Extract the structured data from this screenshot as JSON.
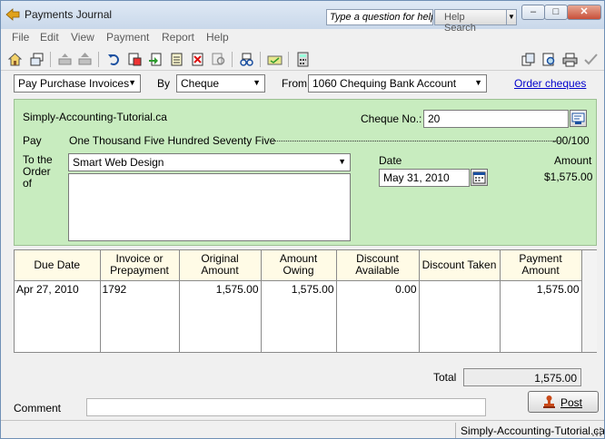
{
  "window": {
    "title": "Payments Journal",
    "help_placeholder": "Type a question for help",
    "help_search_label": "Help Search"
  },
  "menu": [
    "File",
    "Edit",
    "View",
    "Payment",
    "Report",
    "Help"
  ],
  "toolbar_icons": [
    "home-icon",
    "window-icon",
    "print-gray-icon",
    "print-up-icon",
    "undo-icon",
    "recall-icon",
    "adjust-icon",
    "notes-icon",
    "cancel-icon",
    "lookup-icon",
    "track-icon",
    "card-icon",
    "calculator-icon"
  ],
  "selectors": {
    "action": "Pay Purchase Invoices",
    "by_label": "By",
    "method": "Cheque",
    "from_label": "From",
    "account": "1060 Chequing Bank Account",
    "order_cheques": "Order cheques"
  },
  "cheque": {
    "company": "Simply-Accounting-Tutorial.ca",
    "cheque_no_label": "Cheque No.:",
    "cheque_no": "20",
    "pay_label": "Pay",
    "amount_words": "One Thousand Five Hundred Seventy Five",
    "cents": "-00/100",
    "to_order_label": "To the Order of",
    "payee": "Smart Web Design",
    "date_label": "Date",
    "date": "May 31, 2010",
    "amount_label": "Amount",
    "amount": "$1,575.00"
  },
  "table": {
    "headers": [
      "Due Date",
      "Invoice or Prepayment",
      "Original Amount",
      "Amount Owing",
      "Discount Available",
      "Discount Taken",
      "Payment Amount"
    ],
    "rows": [
      {
        "due_date": "Apr 27, 2010",
        "invoice": "1792",
        "original": "1,575.00",
        "owing": "1,575.00",
        "discount_available": "0.00",
        "discount_taken": "",
        "payment": "1,575.00"
      }
    ]
  },
  "footer": {
    "total_label": "Total",
    "total": "1,575.00",
    "comment_label": "Comment",
    "post_label": "Post"
  },
  "status": {
    "text": "Simply-Accounting-Tutorial.ca"
  }
}
